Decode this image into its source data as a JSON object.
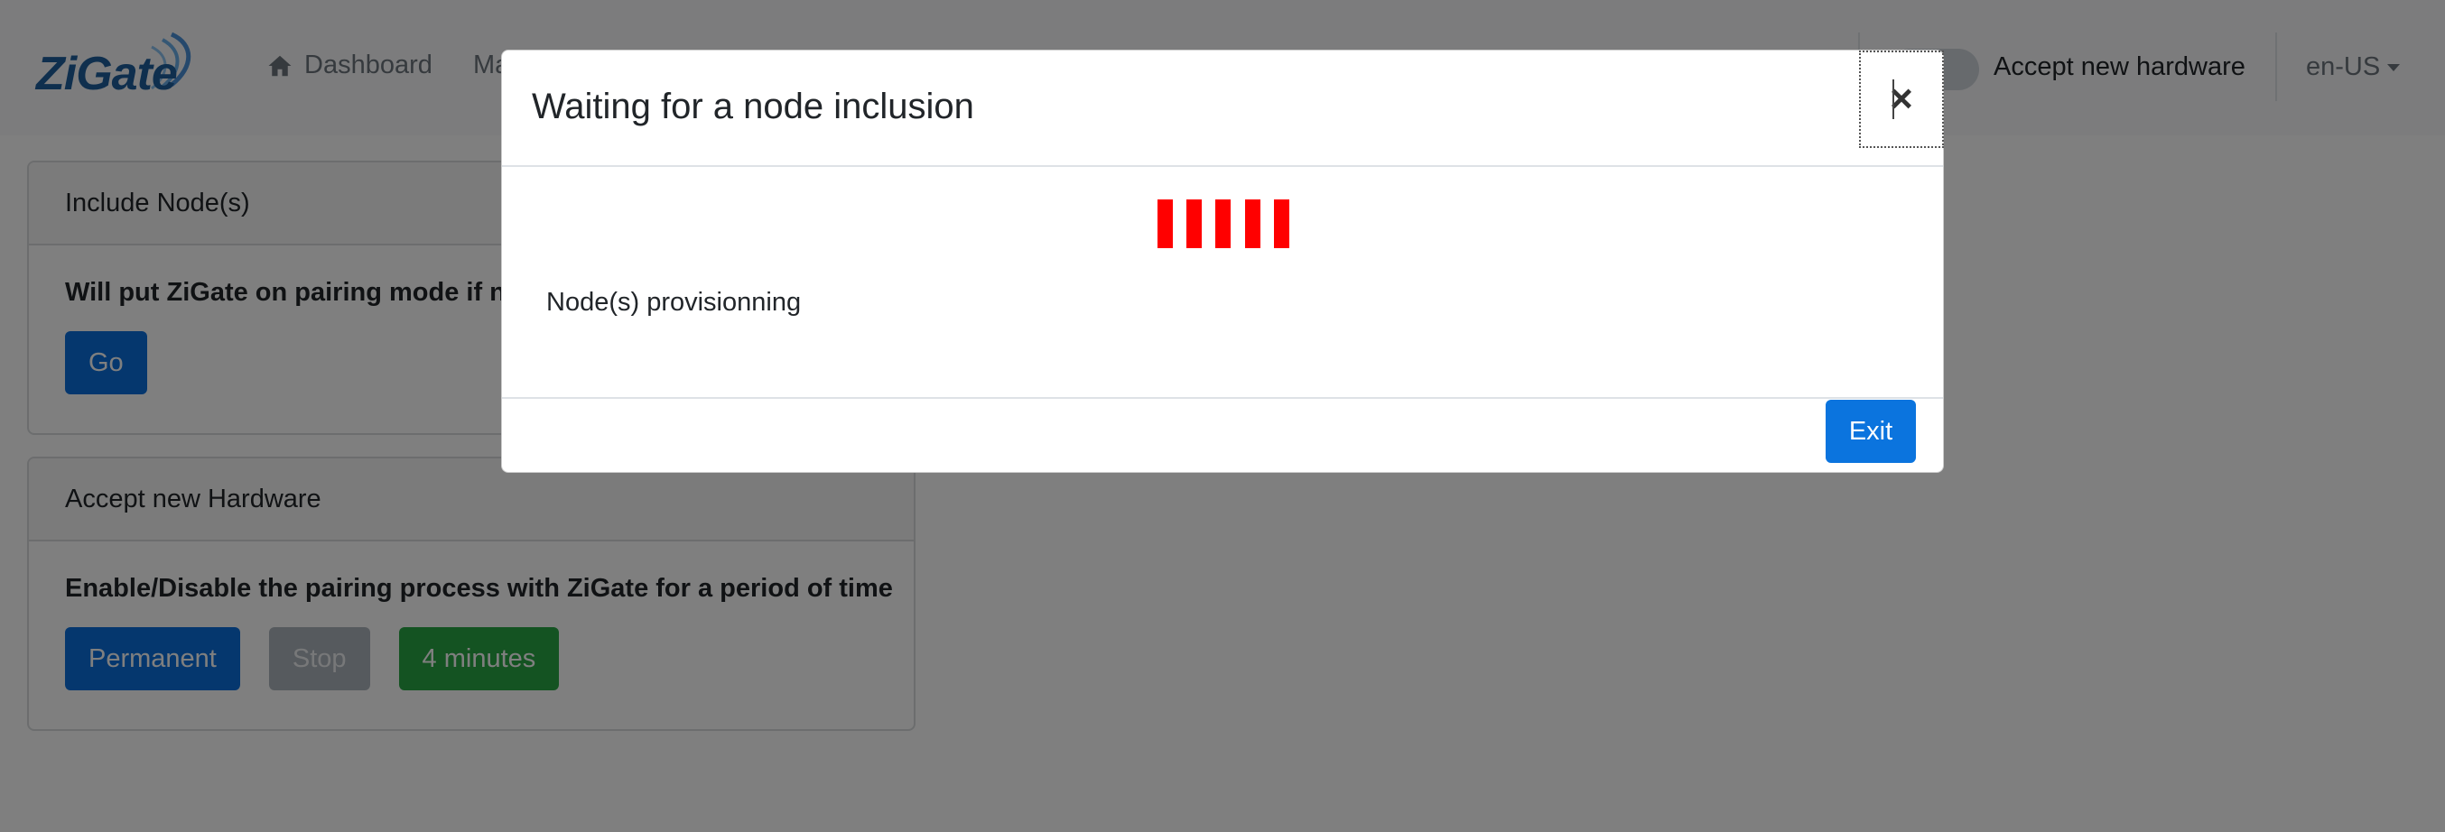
{
  "navbar": {
    "brand": "ZiGate",
    "links": [
      {
        "label": "Dashboard",
        "icon": "home-icon"
      },
      {
        "label": "Ma"
      }
    ],
    "accept_toggle_label": "Accept new hardware",
    "accept_toggle_on": false,
    "language": "en-US"
  },
  "cards": {
    "include": {
      "title": "Include Node(s)",
      "text": "Will put ZiGate on pairing mode if ne",
      "button": "Go"
    },
    "accept": {
      "title": "Accept new Hardware",
      "text": "Enable/Disable the pairing process with ZiGate for a period of time",
      "buttons": {
        "permanent": "Permanent",
        "stop": "Stop",
        "four_minutes": "4 minutes"
      }
    }
  },
  "modal": {
    "title": "Waiting for a node inclusion",
    "close_symbol": "×",
    "status": "Node(s) provisionning",
    "exit_label": "Exit",
    "loader_color": "#ff0000"
  },
  "colors": {
    "primary": "#0b6fdd",
    "success": "#28a745",
    "secondary": "#adb5bd"
  }
}
